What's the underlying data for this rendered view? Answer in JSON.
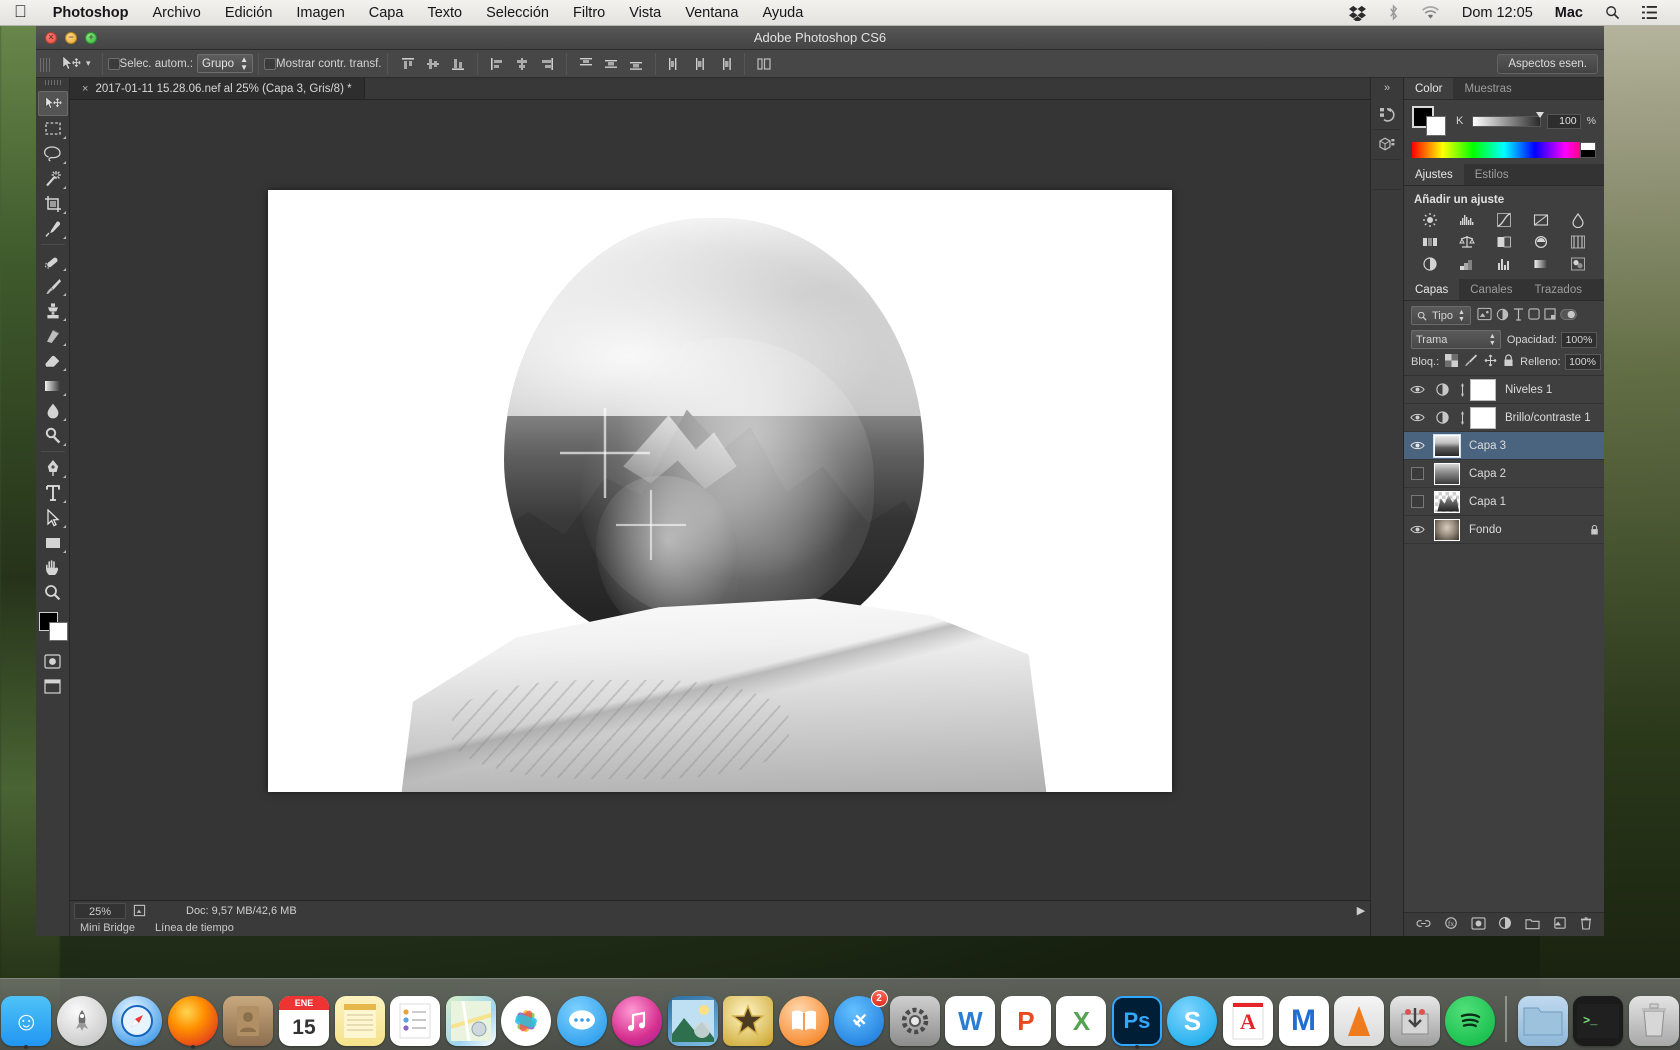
{
  "menubar": {
    "apple": "apple-logo",
    "items": [
      {
        "label": "Photoshop",
        "bold": true
      },
      {
        "label": "Archivo",
        "bold": false
      },
      {
        "label": "Edición",
        "bold": false
      },
      {
        "label": "Imagen",
        "bold": false
      },
      {
        "label": "Capa",
        "bold": false
      },
      {
        "label": "Texto",
        "bold": false
      },
      {
        "label": "Selección",
        "bold": false
      },
      {
        "label": "Filtro",
        "bold": false
      },
      {
        "label": "Vista",
        "bold": false
      },
      {
        "label": "Ventana",
        "bold": false
      },
      {
        "label": "Ayuda",
        "bold": false
      }
    ],
    "right": {
      "dropbox": "dropbox-icon",
      "bluetooth": "bluetooth-icon",
      "wifi": "wifi-icon",
      "clock": "Dom 12:05",
      "user": "Mac",
      "search": "search-icon",
      "notifications": "notification-center-icon"
    }
  },
  "window": {
    "title": "Adobe Photoshop CS6",
    "close": "close-button",
    "minimize": "minimize-button",
    "zoom": "zoom-button"
  },
  "options_bar": {
    "tool_icon": "move-tool-icon",
    "auto_select_label": "Selec. autom.:",
    "auto_select_value": "Grupo",
    "show_transform_label": "Mostrar contr. transf.",
    "workspace_label": "Aspectos esen.",
    "align_icons": [
      "align-top-edges-icon",
      "align-vertical-centers-icon",
      "align-bottom-edges-icon",
      "align-left-edges-icon",
      "align-horizontal-centers-icon",
      "align-right-edges-icon",
      "distribute-top-edges-icon",
      "distribute-vertical-centers-icon",
      "distribute-bottom-edges-icon",
      "distribute-left-edges-icon",
      "distribute-horizontal-centers-icon",
      "distribute-right-edges-icon",
      "auto-align-layers-icon"
    ]
  },
  "document": {
    "tab_title": "2017-01-11 15.28.06.nef al 25% (Capa 3, Gris/8) *",
    "close_icon": "close-tab-icon"
  },
  "toolbar": {
    "tools": [
      {
        "name": "move-tool",
        "glyph": "move",
        "active": true
      },
      {
        "name": "rectangular-marquee-tool",
        "glyph": "marquee",
        "active": false
      },
      {
        "name": "lasso-tool",
        "glyph": "lasso",
        "active": false
      },
      {
        "name": "magic-wand-tool",
        "glyph": "wand",
        "active": false
      },
      {
        "name": "crop-tool",
        "glyph": "crop",
        "active": false
      },
      {
        "name": "eyedropper-tool",
        "glyph": "eyedropper",
        "active": false
      },
      {
        "name": "spot-healing-brush-tool",
        "glyph": "healing",
        "active": false
      },
      {
        "name": "brush-tool",
        "glyph": "brush",
        "active": false
      },
      {
        "name": "clone-stamp-tool",
        "glyph": "stamp",
        "active": false
      },
      {
        "name": "history-brush-tool",
        "glyph": "history",
        "active": false
      },
      {
        "name": "eraser-tool",
        "glyph": "eraser",
        "active": false
      },
      {
        "name": "gradient-tool",
        "glyph": "gradient",
        "active": false
      },
      {
        "name": "blur-tool",
        "glyph": "blur",
        "active": false
      },
      {
        "name": "dodge-tool",
        "glyph": "dodge",
        "active": false
      },
      {
        "name": "pen-tool",
        "glyph": "pen",
        "active": false
      },
      {
        "name": "horizontal-type-tool",
        "glyph": "type",
        "active": false
      },
      {
        "name": "path-selection-tool",
        "glyph": "pathselect",
        "active": false
      },
      {
        "name": "rectangle-tool",
        "glyph": "rectangle",
        "active": false
      },
      {
        "name": "hand-tool",
        "glyph": "hand",
        "active": false
      },
      {
        "name": "zoom-tool",
        "glyph": "zoom",
        "active": false
      }
    ],
    "foreground_color": "#000000",
    "background_color": "#ffffff",
    "quick_mask": "quick-mask-mode",
    "screen_mode": "screen-mode"
  },
  "status_bar": {
    "zoom_level": "25%",
    "doc_info": "Doc: 9,57 MB/42,6 MB",
    "arrow": "status-expand-arrow"
  },
  "bottom_tabs": [
    {
      "label": "Mini Bridge"
    },
    {
      "label": "Línea de tiempo"
    }
  ],
  "mini_dock": {
    "collapse": "collapse-panels-icon",
    "items": [
      "history-icon",
      "3d-icon",
      "extra-panel-icon"
    ]
  },
  "color_panel": {
    "tabs": [
      {
        "label": "Color",
        "active": true
      },
      {
        "label": "Muestras",
        "active": false
      }
    ],
    "channel_label": "K",
    "value": "100",
    "unit": "%",
    "foreground": "#000000",
    "background": "#ffffff"
  },
  "adjustments_panel": {
    "tabs": [
      {
        "label": "Ajustes",
        "active": true
      },
      {
        "label": "Estilos",
        "active": false
      }
    ],
    "title": "Añadir un ajuste",
    "icons": [
      "brightness-contrast-icon",
      "levels-icon",
      "curves-icon",
      "exposure-icon",
      "vibrance-icon",
      "hue-saturation-icon",
      "color-balance-icon",
      "black-white-icon",
      "photo-filter-icon",
      "channel-mixer-icon",
      "invert-icon",
      "posterize-icon",
      "threshold-icon",
      "gradient-map-icon",
      "selective-color-icon"
    ]
  },
  "layers_panel": {
    "tabs": [
      {
        "label": "Capas",
        "active": true
      },
      {
        "label": "Canales",
        "active": false
      },
      {
        "label": "Trazados",
        "active": false
      }
    ],
    "filter_label": "Tipo",
    "filter_icon": "search-icon",
    "blend_mode": "Trama",
    "opacity_label": "Opacidad:",
    "opacity_value": "100%",
    "lock_label": "Bloq.:",
    "fill_label": "Relleno:",
    "fill_value": "100%",
    "lock_icons": [
      "lock-transparent-pixels-icon",
      "lock-image-pixels-icon",
      "lock-position-icon",
      "lock-all-icon"
    ],
    "layers": [
      {
        "name": "Niveles 1",
        "visible": true,
        "selected": false,
        "kind": "adjustment",
        "thumb": "white",
        "linked": true,
        "locked": false
      },
      {
        "name": "Brillo/contraste 1",
        "visible": true,
        "selected": false,
        "kind": "adjustment",
        "thumb": "white",
        "linked": true,
        "locked": false
      },
      {
        "name": "Capa 3",
        "visible": true,
        "selected": true,
        "kind": "pixel",
        "thumb": "mountain",
        "linked": false,
        "locked": false
      },
      {
        "name": "Capa 2",
        "visible": false,
        "selected": false,
        "kind": "pixel",
        "thumb": "mountain2",
        "linked": false,
        "locked": false
      },
      {
        "name": "Capa 1",
        "visible": false,
        "selected": false,
        "kind": "pixel",
        "thumb": "checker",
        "linked": false,
        "locked": false
      },
      {
        "name": "Fondo",
        "visible": true,
        "selected": false,
        "kind": "pixel",
        "thumb": "portrait",
        "linked": false,
        "locked": true
      }
    ],
    "footer_icons": [
      "link-layers-icon",
      "layer-style-icon",
      "layer-mask-icon",
      "new-fill-adjustment-icon",
      "new-group-icon",
      "new-layer-icon",
      "delete-layer-icon"
    ]
  },
  "dock": {
    "items": [
      {
        "name": "finder",
        "label": "Finder",
        "running": true
      },
      {
        "name": "launchpad",
        "label": "Launchpad",
        "running": false
      },
      {
        "name": "safari",
        "label": "Safari",
        "running": false
      },
      {
        "name": "firefox",
        "label": "Firefox",
        "running": true
      },
      {
        "name": "contacts",
        "label": "Contactos",
        "running": false
      },
      {
        "name": "calendar",
        "label": "Calendario",
        "running": false,
        "badge_month": "ENE",
        "badge_day": "15"
      },
      {
        "name": "notes",
        "label": "Notas",
        "running": false
      },
      {
        "name": "reminders",
        "label": "Recordatorios",
        "running": false
      },
      {
        "name": "maps",
        "label": "Mapas",
        "running": false
      },
      {
        "name": "photos",
        "label": "Fotos",
        "running": false
      },
      {
        "name": "messages",
        "label": "Mensajes",
        "running": false
      },
      {
        "name": "itunes",
        "label": "iTunes",
        "running": false
      },
      {
        "name": "preview",
        "label": "Vista previa",
        "running": false
      },
      {
        "name": "imovie",
        "label": "iMovie",
        "running": false
      },
      {
        "name": "ibooks",
        "label": "iBooks",
        "running": false
      },
      {
        "name": "appstore",
        "label": "App Store",
        "running": false,
        "badge": "2"
      },
      {
        "name": "system-preferences",
        "label": "Preferencias",
        "running": false
      },
      {
        "name": "word",
        "label": "Word",
        "glyph": "W",
        "running": false
      },
      {
        "name": "powerpoint",
        "label": "PowerPoint",
        "glyph": "P",
        "running": false
      },
      {
        "name": "excel",
        "label": "Excel",
        "glyph": "X",
        "running": false
      },
      {
        "name": "photoshop",
        "label": "Photoshop",
        "glyph": "Ps",
        "running": true
      },
      {
        "name": "skype",
        "label": "Skype",
        "glyph": "S",
        "running": false
      },
      {
        "name": "acrobat-reader",
        "label": "Adobe Reader",
        "running": false
      },
      {
        "name": "malwarebytes",
        "label": "Malwarebytes",
        "glyph": "M",
        "running": false
      },
      {
        "name": "vlc",
        "label": "VLC",
        "running": false
      },
      {
        "name": "transmission",
        "label": "Transmission",
        "running": false
      },
      {
        "name": "spotify",
        "label": "Spotify",
        "running": false
      }
    ],
    "right_items": [
      {
        "name": "downloads-folder",
        "label": "Descargas"
      },
      {
        "name": "documents-stack",
        "label": "Documentos"
      },
      {
        "name": "trash",
        "label": "Papelera"
      }
    ]
  }
}
